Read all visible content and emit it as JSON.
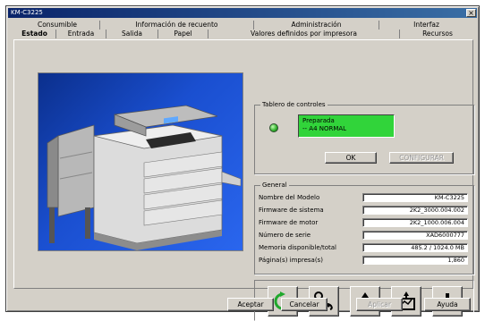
{
  "window": {
    "title": "KM-C3225"
  },
  "tabs_row1": [
    "Consumible",
    "Información de recuento",
    "Administración",
    "Interfaz"
  ],
  "tabs_row2": [
    "Estado",
    "Entrada",
    "Salida",
    "Papel",
    "Valores definidos por impresora",
    "Recursos"
  ],
  "control_panel": {
    "title": "Tablero de controles",
    "status_lines": [
      "Preparada",
      "-- A4 NORMAL"
    ],
    "buttons": [
      "OK",
      "CONFIGURAR"
    ],
    "colors": {
      "display": "#31d43a",
      "led": "#2fae2a"
    }
  },
  "general": {
    "title": "General",
    "rows": [
      {
        "label": "Nombre del Modelo",
        "value": "KM-C3225"
      },
      {
        "label": "Firmware de sistema",
        "value": "2K2_3000.004.002"
      },
      {
        "label": "Firmware de motor",
        "value": "2K2_1000.006.004"
      },
      {
        "label": "Número de serie",
        "value": "XAD6000777"
      },
      {
        "label": "Memoria disponible/total",
        "value": "485.2 / 1024.0 MB"
      },
      {
        "label": "Página(s) impresa(s)",
        "value": "1,860"
      }
    ]
  },
  "icons": [
    "refresh-icon",
    "tools-icon",
    "output-tray-icon",
    "consumables-icon",
    "alert-icon"
  ],
  "dialog_buttons": {
    "accept": "Aceptar",
    "cancel": "Cancelar",
    "apply": "Aplicar",
    "help": "Ayuda"
  }
}
